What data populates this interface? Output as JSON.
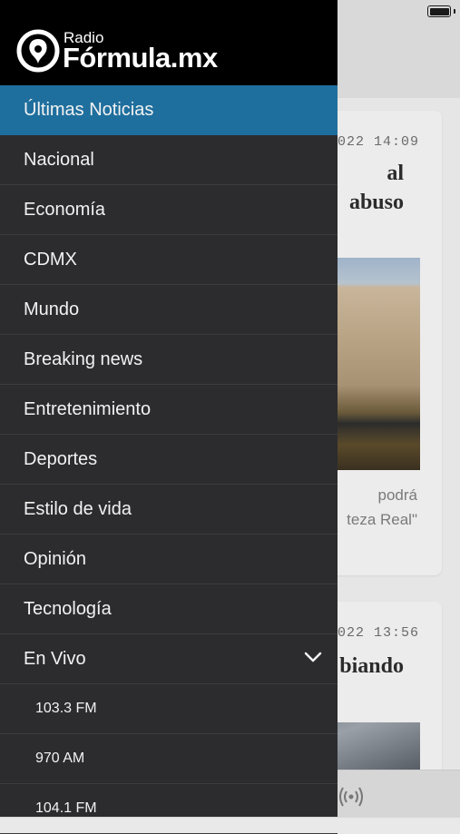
{
  "status_bar": {
    "battery_icon": "battery-icon"
  },
  "background": {
    "cards": [
      {
        "time": "2022 14:09",
        "headline_lines": [
          "al",
          "abuso"
        ],
        "summary_lines": [
          "podrá",
          "teza Real\""
        ]
      },
      {
        "time": "2022 13:56",
        "headline_lines": [
          "biando"
        ]
      }
    ],
    "player_icon": "radio-broadcast-icon"
  },
  "drawer": {
    "logo": {
      "small": "Radio",
      "big": "Fórmula.mx"
    },
    "accent_color": "#1f6f9e",
    "menu_items": [
      {
        "label": "Últimas Noticias",
        "active": true
      },
      {
        "label": "Nacional"
      },
      {
        "label": "Economía"
      },
      {
        "label": "CDMX"
      },
      {
        "label": "Mundo"
      },
      {
        "label": "Breaking news"
      },
      {
        "label": "Entretenimiento"
      },
      {
        "label": "Deportes"
      },
      {
        "label": "Estilo de vida"
      },
      {
        "label": "Opinión"
      },
      {
        "label": "Tecnología"
      },
      {
        "label": "En Vivo",
        "expanded": true,
        "icon": "chevron-down-icon"
      }
    ],
    "sub_items": [
      {
        "label": "103.3 FM"
      },
      {
        "label": "970 AM"
      },
      {
        "label": "104.1 FM"
      }
    ]
  }
}
